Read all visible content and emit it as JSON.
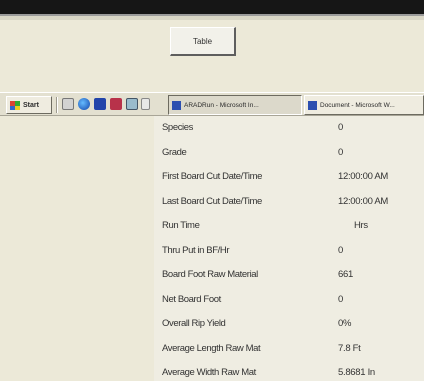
{
  "dialog": {
    "button_label": "Table"
  },
  "taskbar": {
    "start_label": "Start",
    "quick_launch": [
      "explorer-icon",
      "ie-icon",
      "media-player-icon",
      "word-icon",
      "network-icon",
      "desktop-icon"
    ],
    "tasks": [
      {
        "label": "ARADRun - Microsoft In...",
        "active": true
      },
      {
        "label": "Document - Microsoft W...",
        "active": false
      }
    ]
  },
  "properties": [
    {
      "label": "Species",
      "value": "0"
    },
    {
      "label": "Grade",
      "value": "0"
    },
    {
      "label": "First Board Cut Date/Time",
      "value": "12:00:00 AM"
    },
    {
      "label": "Last Board Cut Date/Time",
      "value": "12:00:00 AM"
    },
    {
      "label": "Run Time",
      "value": "Hrs"
    },
    {
      "label": "Thru Put in BF/Hr",
      "value": "0"
    },
    {
      "label": "Board Foot Raw Material",
      "value": "661"
    },
    {
      "label": "Net Board Foot",
      "value": "0"
    },
    {
      "label": "Overall Rip Yield",
      "value": "0%"
    },
    {
      "label": "Average Length Raw Mat",
      "value": "7.8 Ft"
    },
    {
      "label": "Average Width Raw Mat",
      "value": "5.8681 In"
    }
  ]
}
